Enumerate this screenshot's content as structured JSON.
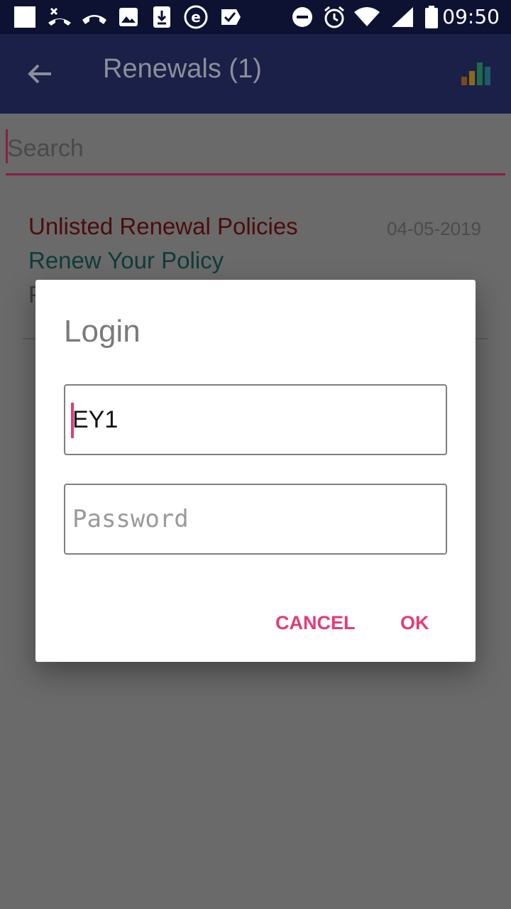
{
  "status_bar": {
    "time": "09:50",
    "icons_left": [
      "square-icon",
      "missed-call-icon",
      "call-end-icon",
      "image-icon",
      "download-icon",
      "e-icon",
      "check-icon"
    ],
    "icons_right": [
      "dnd-icon",
      "alarm-icon",
      "wifi-icon",
      "signal-icon",
      "battery-icon"
    ]
  },
  "app_bar": {
    "title": "Renewals (1)",
    "back_icon": "arrow-back-icon",
    "chart_icon": "bar-chart-icon"
  },
  "search": {
    "placeholder": "Search"
  },
  "list": [
    {
      "title": "Unlisted Renewal Policies",
      "date": "04-05-2019",
      "subtitle": "Renew Your Policy",
      "extra": "P"
    }
  ],
  "dialog": {
    "title": "Login",
    "username_value": "EY1",
    "password_placeholder": "Password",
    "cancel_label": "CANCEL",
    "ok_label": "OK",
    "accent_color": "#e33b7a"
  }
}
